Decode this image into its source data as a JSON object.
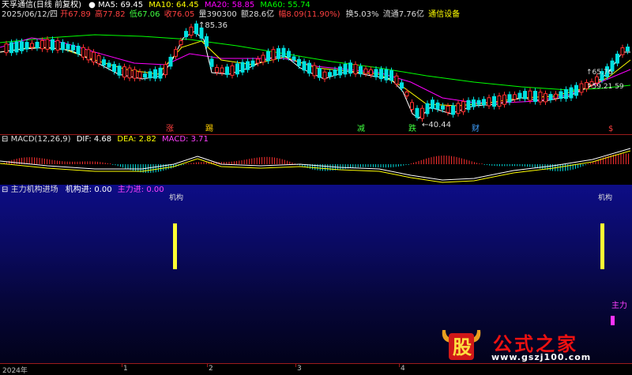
{
  "header": {
    "title": "天孚通信(日线 前复权)",
    "ma5": "MA5: 69.45",
    "ma10": "MA10: 64.45",
    "ma20": "MA20: 58.85",
    "ma60": "MA60: 55.74",
    "date": "2025/06/12/四",
    "open": "开67.89",
    "high": "高77.82",
    "low": "低67.06",
    "close": "收76.05",
    "volume": "量390300",
    "amount": "额28.6亿",
    "change": "幅8.09(11.90%)",
    "turnover": "换5.03%",
    "float": "流通7.76亿",
    "sector": "通信设备"
  },
  "price_annotations": {
    "high_mark": "85.36",
    "low_mark": "←40.44",
    "right_a": "65.76",
    "right_b": "59.21",
    "right_c": "59"
  },
  "signals": [
    {
      "label": "涨",
      "color": "#ff4040"
    },
    {
      "label": "踢",
      "color": "#ffd000"
    },
    {
      "label": "减",
      "color": "#40ff40"
    },
    {
      "label": "跌",
      "color": "#40ff40"
    },
    {
      "label": "财",
      "color": "#40a0ff"
    },
    {
      "label": "$",
      "color": "#ff4040"
    }
  ],
  "macd": {
    "title": "MACD(12,26,9)",
    "dif": "DIF: 4.68",
    "dea": "DEA: 2.82",
    "macd": "MACD: 3.71"
  },
  "indicator": {
    "title": "主力机构进场",
    "jg": "机构进: 0.00",
    "zl": "主力进: 0.00",
    "bar_label_left": "机构",
    "bar_label_right": "机构",
    "zhuli_label": "主力"
  },
  "axis": {
    "labels": [
      "2024年",
      "1",
      "2",
      "3",
      "4"
    ]
  },
  "watermark": {
    "logo": "股",
    "name": "公式之家",
    "url": "www.gszj100.com"
  },
  "colors": {
    "up": "#ff3030",
    "down": "#00e0e0",
    "ma5": "#ffffff",
    "ma10": "#ffff00",
    "ma20": "#ff00ff",
    "ma60": "#00ff00",
    "bar": "#ffff33",
    "zhuli": "#ff33ff"
  }
}
